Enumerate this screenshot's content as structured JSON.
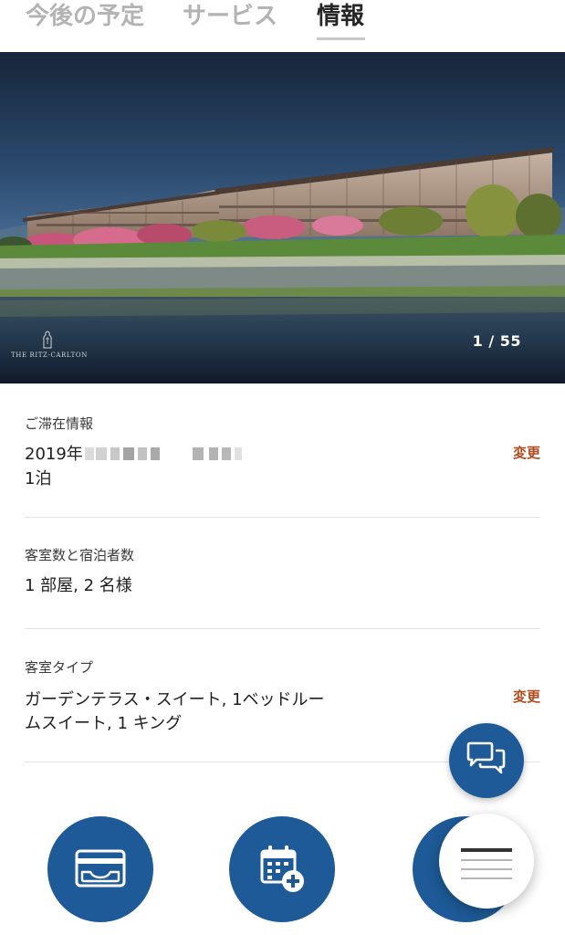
{
  "tabs": [
    {
      "label": "今後の予定",
      "active": false
    },
    {
      "label": "サービス",
      "active": false
    },
    {
      "label": "情報",
      "active": true
    }
  ],
  "hero": {
    "photo_counter": "1 / 55",
    "logo_text": "THE RITZ-CARLTON"
  },
  "stay": {
    "label": "ご滞在情報",
    "date_visible": "2019年",
    "nights": "1泊",
    "change_label": "変更"
  },
  "rooms_guests": {
    "label": "客室数と宿泊者数",
    "value": "1 部屋, 2 名様"
  },
  "room_type": {
    "label": "客室タイプ",
    "value_line1": "ガーデンテラス・スイート, 1ベッドルー",
    "value_line2": "ムスイート, 1 キング",
    "change_label": "変更"
  },
  "buttons": {
    "chat": "chat-bubbles-icon",
    "wallet": "wallet-card-icon",
    "calendar": "calendar-add-icon",
    "menu": "menu-lines-icon"
  },
  "colors": {
    "primary_blue": "#1d5a97",
    "change_link": "#b54a1e",
    "tab_active": "#262626",
    "tab_inactive": "#b3b3b3"
  }
}
